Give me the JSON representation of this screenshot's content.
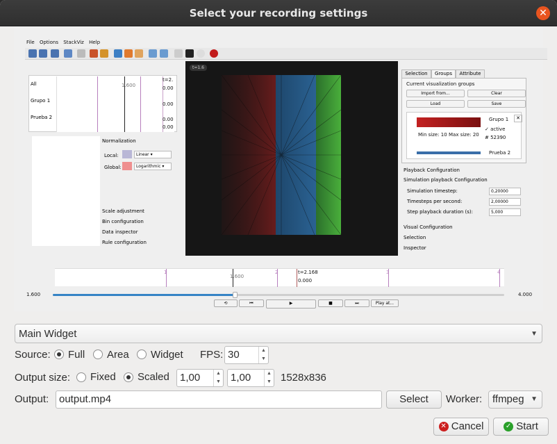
{
  "window": {
    "title": "Select your recording settings",
    "close_symbol": "✕"
  },
  "preview": {
    "menu": [
      "File",
      "Options",
      "StackViz",
      "Help"
    ],
    "left_panel": {
      "rows": [
        "All",
        "Grupo 1",
        "Prueba 2"
      ],
      "hist_label": "1.600",
      "hist_top_right": "t=2.",
      "hist_values": [
        "0.00",
        "0.00",
        "0.00",
        "0.00"
      ]
    },
    "normalization": {
      "title": "Normalization",
      "local_label": "Local:",
      "local_value": "Linear",
      "global_label": "Global:",
      "global_value": "Logarithmic",
      "sections": [
        "Scale adjustment",
        "Bin configuration",
        "Data inspector",
        "Rule configuration"
      ]
    },
    "viz": {
      "time_badge": "t=1.6"
    },
    "right_panel": {
      "tabs": [
        "Selection",
        "Groups",
        "Attribute"
      ],
      "groups_title": "Current visualization groups",
      "buttons": [
        "Import from...",
        "Clear",
        "Load",
        "Save"
      ],
      "group": {
        "name": "Grupo 1",
        "active": "active",
        "count": "# 52390",
        "min_size": "Min size: 10",
        "max_size": "Max size: 20",
        "next": "Prueba 2"
      },
      "playback_title": "Playback Configuration",
      "sim_title": "Simulation playback Configuration",
      "sim_rows": [
        {
          "label": "Simulation timestep:",
          "value": "0,20000"
        },
        {
          "label": "Timesteps per second:",
          "value": "2,00000"
        },
        {
          "label": "Step playback duration (s):",
          "value": "5,000"
        }
      ],
      "sections": [
        "Visual Configuration",
        "Selection",
        "Inspector"
      ]
    },
    "timeline": {
      "marker_time": "t=2.168",
      "marker_value": "0.000",
      "mid_label": "1.600",
      "ticks": [
        "1",
        "2",
        "3",
        "4"
      ],
      "start": "1.600",
      "end": "4.000",
      "progress": 0.31
    },
    "playback_buttons": [
      "⟲",
      "⏮",
      "▶",
      "■",
      "⏭",
      "Play at..."
    ]
  },
  "form": {
    "widget_select": "Main Widget",
    "source_label": "Source:",
    "source_options": [
      "Full",
      "Area",
      "Widget"
    ],
    "source_selected": "Full",
    "fps_label": "FPS:",
    "fps_value": "30",
    "output_size_label": "Output size:",
    "size_options": [
      "Fixed",
      "Scaled"
    ],
    "size_selected": "Scaled",
    "scale_x": "1,00",
    "scale_y": "1,00",
    "resolution": "1528x836",
    "output_label": "Output:",
    "output_value": "output.mp4",
    "select_button": "Select",
    "worker_label": "Worker:",
    "worker_value": "ffmpeg",
    "cancel_button": "Cancel",
    "start_button": "Start"
  },
  "colors": {
    "close": "#e9541f",
    "accent": "#3584c5",
    "start_check": "#2aa02a",
    "cancel_x": "#cc1f1f"
  }
}
